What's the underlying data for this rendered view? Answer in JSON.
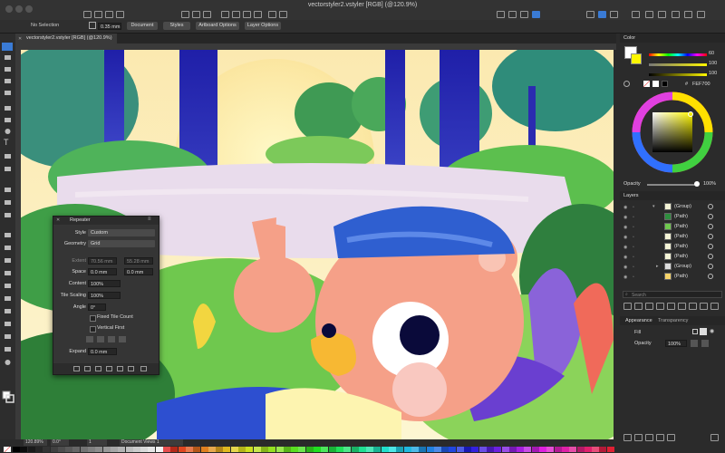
{
  "window": {
    "title": "vectorstyler2.vstyler [RGB] (@120.9%)"
  },
  "optionsbar": {
    "selection": "No Selection",
    "stroke_width": "0.35 mm",
    "buttons": [
      "Document",
      "Styles",
      "Artboard Options",
      "Layer Options"
    ]
  },
  "doc_tab": {
    "label": "vectorstyler2.vstyler [RGB] (@120.9%)"
  },
  "color_panel": {
    "tab": "Color",
    "sliders": [
      {
        "value": "60"
      },
      {
        "value": "100"
      },
      {
        "value": "100"
      }
    ],
    "hex": "FEF700",
    "opacity_label": "Opacity",
    "opacity_value": "100%"
  },
  "layers_panel": {
    "title": "Layers",
    "rows": [
      "(Group)",
      "(Path)",
      "(Path)",
      "(Path)",
      "(Path)",
      "(Path)",
      "(Group)",
      "(Path)"
    ],
    "search_placeholder": "Search"
  },
  "appearance_panel": {
    "tabs": [
      "Appearance",
      "Transparency"
    ],
    "fill_label": "Fill",
    "opacity_label": "Opacity",
    "opacity_value": "100%"
  },
  "repeater": {
    "title": "Repeater",
    "style_label": "Style",
    "style_value": "Custom",
    "geometry_label": "Geometry",
    "geometry_value": "Grid",
    "extent_label": "Extent",
    "extent_w": "70.56 mm",
    "extent_h": "55.28 mm",
    "space_label": "Space",
    "space_x": "0.0 mm",
    "space_y": "0.0 mm",
    "content_label": "Content",
    "content_value": "100%",
    "tile_scaling_label": "Tile Scaling",
    "tile_scaling_value": "100%",
    "angle_label": "Angle",
    "angle_value": "0°",
    "fixed_tile_count": "Fixed Tile Count",
    "vertical_first": "Vertical First",
    "expand_label": "Expand",
    "expand_value": "0.0 mm"
  },
  "statusbar": {
    "zoom": "120.89%",
    "angle": "0.0°",
    "page": "1",
    "view": "Document Views 1"
  },
  "colors": {
    "accent": "#3a7bd5",
    "yellow": "#fef700",
    "bear": "#f5a088",
    "cap": "#2f5fd0"
  }
}
